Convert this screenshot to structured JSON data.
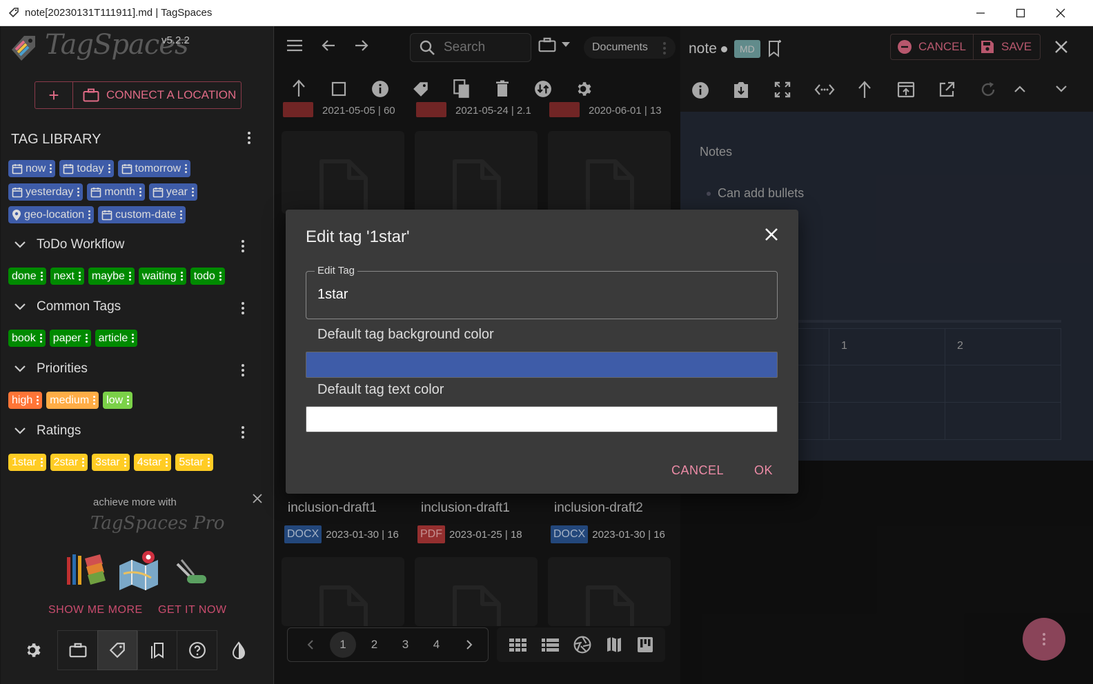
{
  "window": {
    "title": "note[20230131T111911].md | TagSpaces"
  },
  "app": {
    "logo": "TagSpaces",
    "version": "v5.2.2",
    "connect_label": "CONNECT A LOCATION"
  },
  "tag_library": {
    "title": "TAG LIBRARY",
    "smart_tags": [
      {
        "label": "now",
        "icon": "calendar-icon"
      },
      {
        "label": "today",
        "icon": "calendar-icon"
      },
      {
        "label": "tomorrow",
        "icon": "calendar-icon"
      },
      {
        "label": "yesterday",
        "icon": "calendar-icon"
      },
      {
        "label": "month",
        "icon": "calendar-icon"
      },
      {
        "label": "year",
        "icon": "calendar-icon"
      },
      {
        "label": "geo-location",
        "icon": "location-pin-icon"
      },
      {
        "label": "custom-date",
        "icon": "calendar-icon"
      }
    ],
    "groups": [
      {
        "name": "ToDo Workflow",
        "tags": [
          "done",
          "next",
          "maybe",
          "waiting",
          "todo"
        ],
        "bg": "#008a00",
        "fg": "#ffffff"
      },
      {
        "name": "Common Tags",
        "tags": [
          "book",
          "paper",
          "article"
        ],
        "bg": "#008a00",
        "fg": "#ffffff"
      },
      {
        "name": "Priorities",
        "tags": [
          "high",
          "medium",
          "low"
        ]
      },
      {
        "name": "Ratings",
        "tags": [
          "1star",
          "2star",
          "3star",
          "4star",
          "5star"
        ],
        "bg": "#ffcc24",
        "fg": "#ffffff"
      }
    ],
    "priority_colors": [
      {
        "bg": "#ff7537",
        "fg": "#ffffff"
      },
      {
        "bg": "#ffad46",
        "fg": "#ffffff"
      },
      {
        "bg": "#7bd148",
        "fg": "#ffffff"
      }
    ],
    "smart_tag_bg": "#3e5ca8"
  },
  "promo": {
    "text": "achieve more with",
    "logo": "TagSpaces Pro",
    "show_more": "SHOW ME MORE",
    "get_it": "GET IT NOW"
  },
  "toolbar": {
    "search_placeholder": "Search",
    "location": "Documents"
  },
  "files": [
    {
      "title": "inclusion-draft1",
      "ext": "DOCX",
      "meta": "2023-01-30 | 16",
      "ext_bg": "#2b5797"
    },
    {
      "title": "inclusion-draft1",
      "ext": "PDF",
      "meta": "2023-01-25 | 18",
      "ext_bg": "#b53a3a"
    },
    {
      "title": "inclusion-draft2",
      "ext": "DOCX",
      "meta": "2023-01-30 | 16",
      "ext_bg": "#2b5797"
    }
  ],
  "top_meta": [
    "2021-05-05 | 60",
    "2021-05-24 | 2.1",
    "2020-06-01 | 13"
  ],
  "pagination": {
    "pages": [
      "1",
      "2",
      "3",
      "4"
    ],
    "current": "1"
  },
  "editor": {
    "name": "note",
    "ext": "MD",
    "cancel": "CANCEL",
    "save": "SAVE",
    "heading": "Notes",
    "bullet": "Can add bullets",
    "table_headers": [
      "1",
      "2"
    ]
  },
  "dialog": {
    "title": "Edit tag '1star'",
    "field_label": "Edit Tag",
    "field_value": "1star",
    "bg_label": "Default tag background color",
    "bg_color": "#3e5ca8",
    "text_label": "Default tag text color",
    "text_color": "#ffffff",
    "cancel": "CANCEL",
    "ok": "OK"
  }
}
